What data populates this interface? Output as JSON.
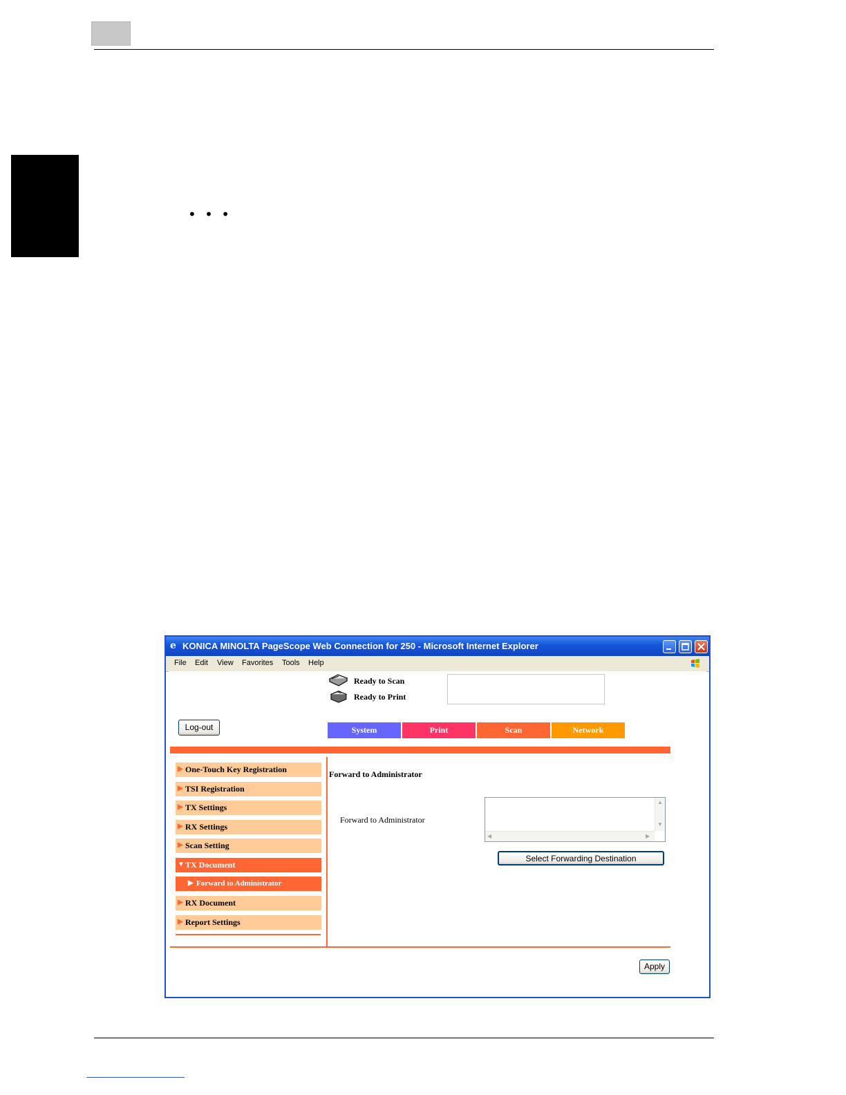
{
  "page": {
    "ellipsis": "• • •"
  },
  "window": {
    "title": "KONICA MINOLTA PageScope Web Connection for 250 - Microsoft Internet Explorer",
    "menu": [
      "File",
      "Edit",
      "View",
      "Favorites",
      "Tools",
      "Help"
    ]
  },
  "status": {
    "scan": "Ready to Scan",
    "print": "Ready to Print"
  },
  "logout_label": "Log-out",
  "tabs": [
    {
      "label": "System",
      "color": "#6666ff"
    },
    {
      "label": "Print",
      "color": "#ff3366"
    },
    {
      "label": "Scan",
      "color": "#ff6633"
    },
    {
      "label": "Network",
      "color": "#ff9900"
    }
  ],
  "sidebar": {
    "items": [
      {
        "label": "One-Touch Key Registration",
        "state": "normal"
      },
      {
        "label": "TSI Registration",
        "state": "normal"
      },
      {
        "label": "TX Settings",
        "state": "normal"
      },
      {
        "label": "RX Settings",
        "state": "normal"
      },
      {
        "label": "Scan Setting",
        "state": "normal"
      },
      {
        "label": "TX Document",
        "state": "expanded"
      },
      {
        "label": "Forward to Administrator",
        "state": "selected-sub"
      },
      {
        "label": "RX Document",
        "state": "normal"
      },
      {
        "label": "Report Settings",
        "state": "normal"
      }
    ]
  },
  "main": {
    "heading": "Forward to Administrator",
    "field_label": "Forward to Administrator",
    "select_button": "Select Forwarding Destination",
    "apply_button": "Apply"
  },
  "colors": {
    "accent": "#ff6633",
    "sidebar_bg": "#ffcc99",
    "titlebar": "#1554d9"
  }
}
